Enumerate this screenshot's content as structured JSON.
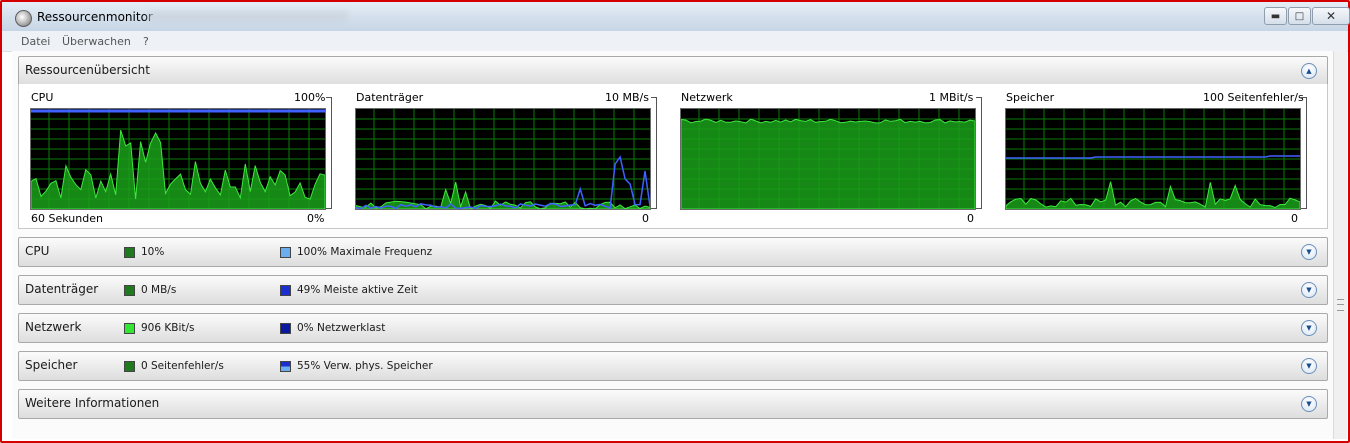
{
  "window": {
    "title": "Ressourcenmonitor",
    "controls": {
      "minimize": "▬",
      "maximize": "□",
      "close": "✕"
    }
  },
  "menu": [
    "Datei",
    "Überwachen",
    "?"
  ],
  "overview": {
    "title": "Ressourcenübersicht",
    "graphs": [
      {
        "name": "CPU",
        "scale_max": "100%",
        "scale_min": "0%",
        "time_label": "60 Sekunden"
      },
      {
        "name": "Datenträger",
        "scale_max": "10 MB/s",
        "scale_min": "0"
      },
      {
        "name": "Netzwerk",
        "scale_max": "1 MBit/s",
        "scale_min": "0"
      },
      {
        "name": "Speicher",
        "scale_max": "100 Seitenfehler/s",
        "scale_min": "0"
      }
    ]
  },
  "sections": [
    {
      "title": "CPU",
      "metric1": "10%",
      "metric2": "100% Maximale Frequenz"
    },
    {
      "title": "Datenträger",
      "metric1": "0 MB/s",
      "metric2": "49% Meiste aktive Zeit"
    },
    {
      "title": "Netzwerk",
      "metric1": "906 KBit/s",
      "metric2": "0% Netzwerklast"
    },
    {
      "title": "Speicher",
      "metric1": "0 Seitenfehler/s",
      "metric2": "55% Verw. phys. Speicher"
    },
    {
      "title": "Weitere Informationen"
    }
  ],
  "colors": {
    "graph_bg": "#000000",
    "grid": "#0a7a0a",
    "green_fill": "#1aa01a",
    "green_line": "#3ee83e",
    "blue_line": "#4060ff",
    "swatch_dark_green": "#1f7a1f",
    "swatch_light_blue": "#6aaef0",
    "swatch_blue": "#1b2fd0",
    "swatch_bright_green": "#33e633",
    "swatch_dark_blue": "#0a1aa0"
  }
}
